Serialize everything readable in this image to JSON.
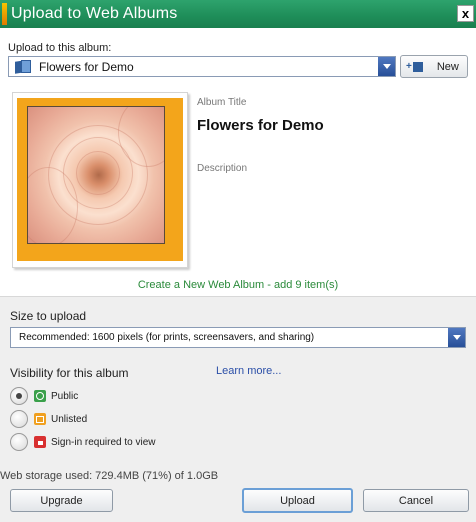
{
  "window": {
    "title": "Upload to Web Albums",
    "close_label": "x"
  },
  "album_select": {
    "label": "Upload to this album:",
    "selected": "Flowers for Demo",
    "new_button": "New",
    "new_icon": "plus-album-icon"
  },
  "album": {
    "title_label": "Album Title",
    "title_value": "Flowers for Demo",
    "description_label": "Description"
  },
  "create_link": "Create a New Web Album - add 9 item(s)",
  "size": {
    "label": "Size to upload",
    "selected": "Recommended: 1600 pixels (for prints, screensavers, and sharing)"
  },
  "visibility": {
    "label": "Visibility for this album",
    "learn_more": "Learn more...",
    "options": [
      {
        "label": "Public",
        "selected": true,
        "icon": "public-icon",
        "color": "#3aa04a"
      },
      {
        "label": "Unlisted",
        "selected": false,
        "icon": "unlisted-icon",
        "color": "#f0a020"
      },
      {
        "label": "Sign-in required to view",
        "selected": false,
        "icon": "lock-icon",
        "color": "#d83030"
      }
    ]
  },
  "storage_text": "Web storage used: 729.4MB (71%) of 1.0GB",
  "buttons": {
    "upgrade": "Upgrade",
    "upload": "Upload",
    "cancel": "Cancel"
  },
  "colors": {
    "titlebar": "#1f8f5a",
    "frame": "#f3a51b",
    "link": "#2b4fa8",
    "create_link": "#2a8a3a"
  }
}
